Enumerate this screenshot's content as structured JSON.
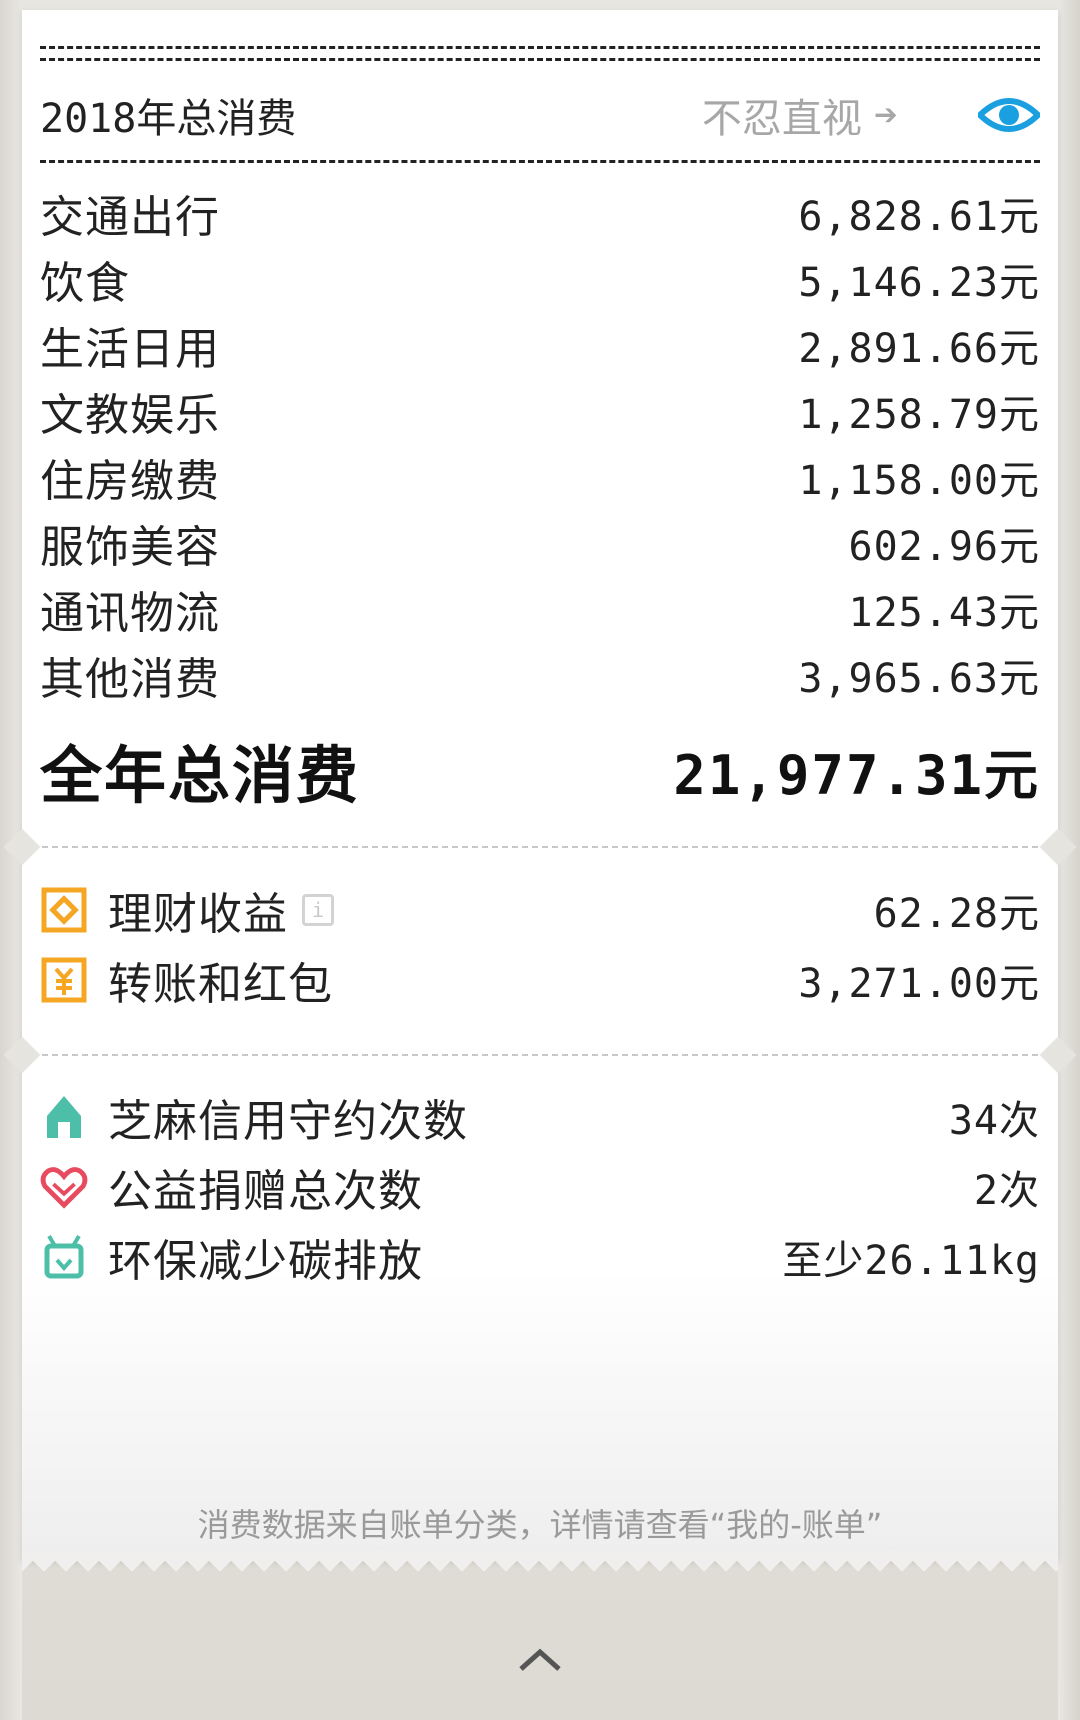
{
  "header": {
    "title": "2018年总消费",
    "peek_label": "不忍直视",
    "arrow": "➔"
  },
  "categories": [
    {
      "label": "交通出行",
      "amount": "6,828.61元"
    },
    {
      "label": "饮食",
      "amount": "5,146.23元"
    },
    {
      "label": "生活日用",
      "amount": "2,891.66元"
    },
    {
      "label": "文教娱乐",
      "amount": "1,258.79元"
    },
    {
      "label": "住房缴费",
      "amount": "1,158.00元"
    },
    {
      "label": "服饰美容",
      "amount": "602.96元"
    },
    {
      "label": "通讯物流",
      "amount": "125.43元"
    },
    {
      "label": "其他消费",
      "amount": "3,965.63元"
    }
  ],
  "total": {
    "label": "全年总消费",
    "amount": "21,977.31元"
  },
  "finance": [
    {
      "label": "理财收益",
      "amount": "62.28元",
      "icon": "wealth-icon"
    },
    {
      "label": "转账和红包",
      "amount": "3,271.00元",
      "icon": "transfer-icon"
    }
  ],
  "credit": [
    {
      "label": "芝麻信用守约次数",
      "amount": "34次",
      "icon": "sesame-icon"
    },
    {
      "label": "公益捐赠总次数",
      "amount": "2次",
      "icon": "heart-icon"
    },
    {
      "label": "环保减少碳排放",
      "amount": "至少26.11kg",
      "icon": "eco-icon"
    }
  ],
  "info_symbol": "i",
  "footer_note": "消费数据来自账单分类，详情请查看“我的-账单”",
  "colors": {
    "accent_blue": "#1aa0e0",
    "finance_orange": "#f5a623",
    "eco_teal": "#4dbfa8",
    "heart_red": "#e84a5f"
  }
}
